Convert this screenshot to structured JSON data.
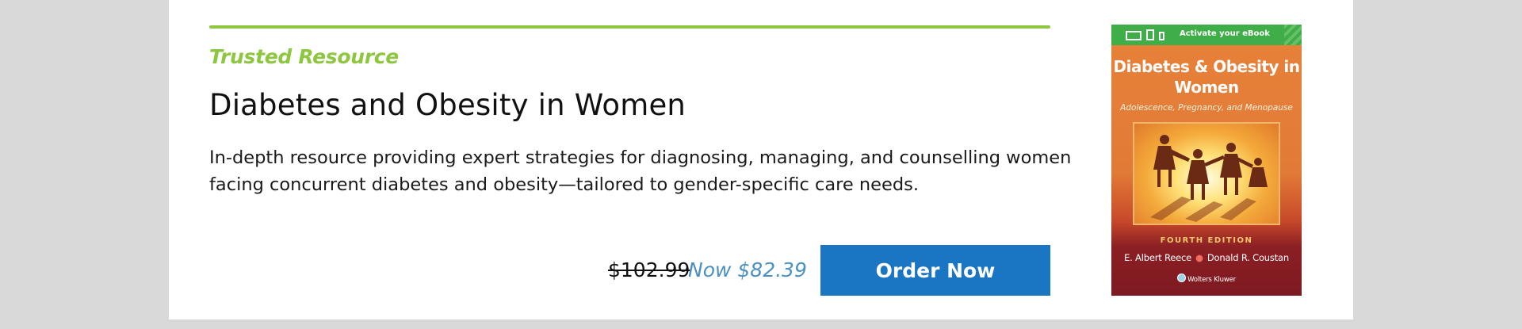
{
  "promo": {
    "eyebrow": "Trusted Resource",
    "title": "Diabetes and Obesity in Women",
    "description": "In-depth resource providing expert strategies for diagnosing, managing, and counselling women facing concurrent diabetes and obesity—tailored to gender-specific care needs.",
    "price_original": "$102.99",
    "price_now": "Now $82.39",
    "order_label": "Order Now",
    "accent_color": "#8dc63f",
    "button_color": "#1a75c2",
    "price_now_color": "#4a90c2"
  },
  "cover": {
    "activate_label": "Activate your eBook",
    "title": "Diabetes & Obesity in Women",
    "subtitle": "Adolescence, Pregnancy, and Menopause",
    "edition": "FOURTH EDITION",
    "author_1": "E. Albert Reece",
    "author_2": "Donald R. Coustan",
    "publisher": "Wolters Kluwer",
    "device_icons": [
      "laptop-icon",
      "tablet-icon",
      "phone-icon"
    ]
  }
}
